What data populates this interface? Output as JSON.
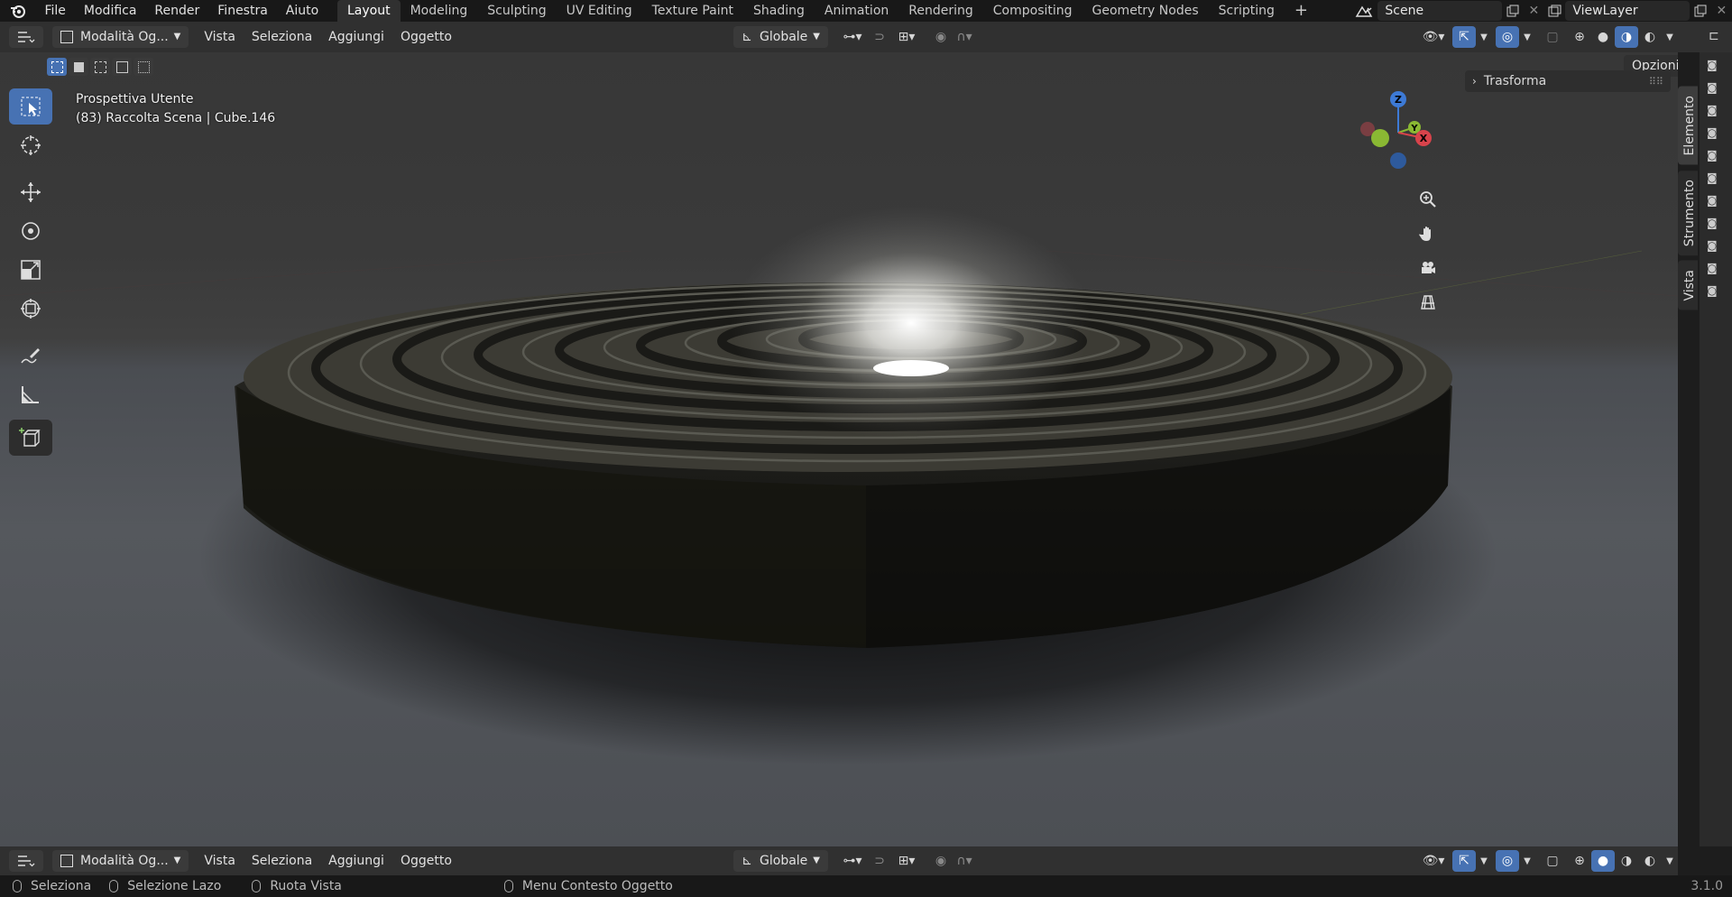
{
  "topbar": {
    "menus": [
      "File",
      "Modifica",
      "Render",
      "Finestra",
      "Aiuto"
    ],
    "workspaces": [
      "Layout",
      "Modeling",
      "Sculpting",
      "UV Editing",
      "Texture Paint",
      "Shading",
      "Animation",
      "Rendering",
      "Compositing",
      "Geometry Nodes",
      "Scripting"
    ],
    "active_workspace": "Layout",
    "add_tab": "+",
    "scene_name": "Scene",
    "view_layer": "ViewLayer"
  },
  "header": {
    "mode": "Modalità Og...",
    "menus": [
      "Vista",
      "Seleziona",
      "Aggiungi",
      "Oggetto"
    ],
    "transform_orientation": "Globale",
    "options": "Opzioni"
  },
  "viewport": {
    "view_name": "Prospettiva Utente",
    "object_info": "(83) Raccolta Scena | Cube.146",
    "gizmo_axes": [
      "Z",
      "Y",
      "X"
    ],
    "sidebar_panel": "Trasforma",
    "sidebar_tabs": [
      "Elemento",
      "Strumento",
      "Vista"
    ]
  },
  "bottom_header": {
    "mode": "Modalità Og...",
    "menus": [
      "Vista",
      "Seleziona",
      "Aggiungi",
      "Oggetto"
    ],
    "transform_orientation": "Globale"
  },
  "statusbar": {
    "items": [
      "Seleziona",
      "Selezione Lazo",
      "Ruota Vista",
      "Menu Contesto Oggetto"
    ],
    "version": "3.1.0"
  },
  "colors": {
    "accent": "#4772b3",
    "axis_x": "#d8434b",
    "axis_y": "#8ab833",
    "axis_z": "#3d7ad6"
  }
}
